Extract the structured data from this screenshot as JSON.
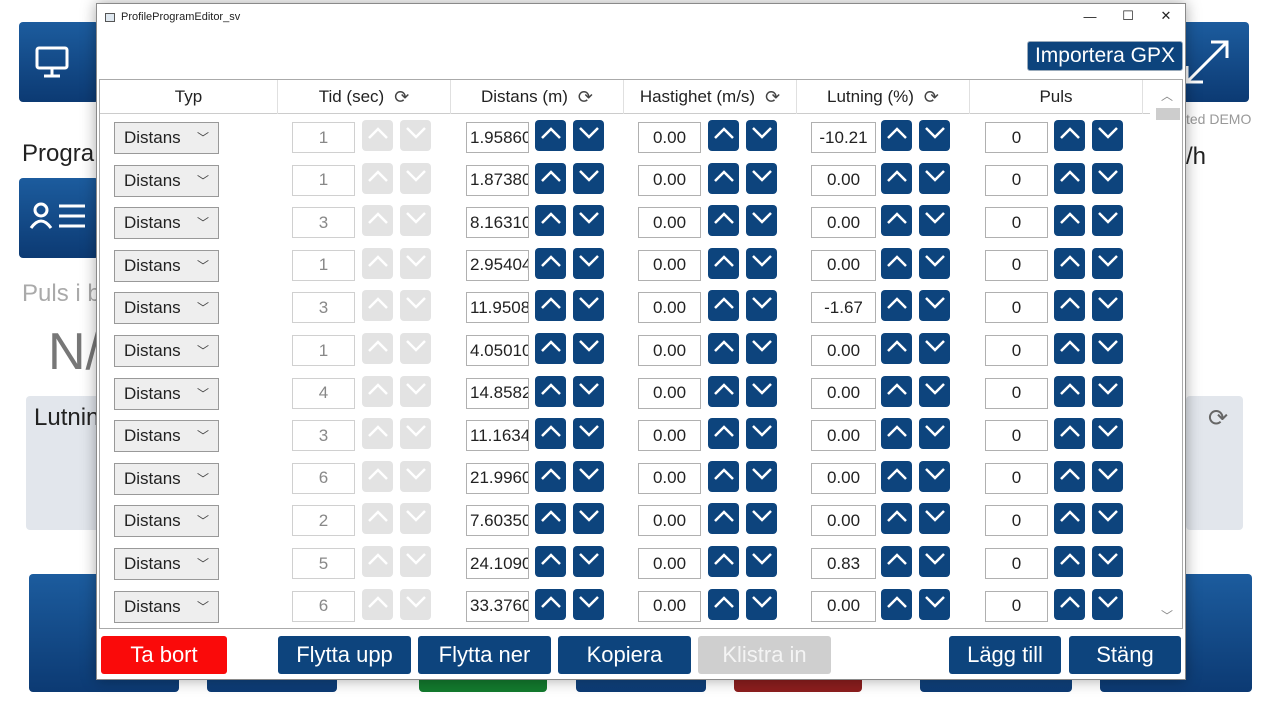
{
  "background": {
    "program_label": "Progra",
    "puls_label": "Puls i b",
    "na_text": "N/",
    "lutning_label": "Lutnin",
    "demo_text": "ted DEMO",
    "wh_text": "/h",
    "monitor_icon": "monitor-icon",
    "user_list_icon": "user-list-icon",
    "expand_icon": "expand-arrow-icon",
    "refresh_icon": "refresh-icon"
  },
  "window": {
    "title": "ProfileProgramEditor_sv",
    "minimize": "—",
    "maximize": "☐",
    "close": "✕",
    "import_gpx_label": "Importera GPX"
  },
  "table": {
    "headers": {
      "typ": "Typ",
      "tid": "Tid (sec)",
      "distans": "Distans (m)",
      "hastighet": "Hastighet (m/s)",
      "lutning": "Lutning (%)",
      "puls": "Puls"
    },
    "rows": [
      {
        "typ": "Distans",
        "tid": "1",
        "distans": "1.95860",
        "hastighet": "0.00",
        "lutning": "-10.21",
        "puls": "0"
      },
      {
        "typ": "Distans",
        "tid": "1",
        "distans": "1.87380",
        "hastighet": "0.00",
        "lutning": "0.00",
        "puls": "0"
      },
      {
        "typ": "Distans",
        "tid": "3",
        "distans": "8.16310",
        "hastighet": "0.00",
        "lutning": "0.00",
        "puls": "0"
      },
      {
        "typ": "Distans",
        "tid": "1",
        "distans": "2.95404",
        "hastighet": "0.00",
        "lutning": "0.00",
        "puls": "0"
      },
      {
        "typ": "Distans",
        "tid": "3",
        "distans": "11.9508",
        "hastighet": "0.00",
        "lutning": "-1.67",
        "puls": "0"
      },
      {
        "typ": "Distans",
        "tid": "1",
        "distans": "4.05010",
        "hastighet": "0.00",
        "lutning": "0.00",
        "puls": "0"
      },
      {
        "typ": "Distans",
        "tid": "4",
        "distans": "14.8582",
        "hastighet": "0.00",
        "lutning": "0.00",
        "puls": "0"
      },
      {
        "typ": "Distans",
        "tid": "3",
        "distans": "11.1634",
        "hastighet": "0.00",
        "lutning": "0.00",
        "puls": "0"
      },
      {
        "typ": "Distans",
        "tid": "6",
        "distans": "21.9960",
        "hastighet": "0.00",
        "lutning": "0.00",
        "puls": "0"
      },
      {
        "typ": "Distans",
        "tid": "2",
        "distans": "7.60350",
        "hastighet": "0.00",
        "lutning": "0.00",
        "puls": "0"
      },
      {
        "typ": "Distans",
        "tid": "5",
        "distans": "24.1090",
        "hastighet": "0.00",
        "lutning": "0.83",
        "puls": "0"
      },
      {
        "typ": "Distans",
        "tid": "6",
        "distans": "33.3760",
        "hastighet": "0.00",
        "lutning": "0.00",
        "puls": "0"
      }
    ]
  },
  "buttons": {
    "remove": "Ta bort",
    "move_up": "Flytta upp",
    "move_down": "Flytta ner",
    "copy": "Kopiera",
    "paste": "Klistra in",
    "add": "Lägg till",
    "close": "Stäng"
  },
  "colors": {
    "accent": "#0d447d",
    "danger": "#fa0a0a",
    "disabled": "#cfcfcf"
  }
}
